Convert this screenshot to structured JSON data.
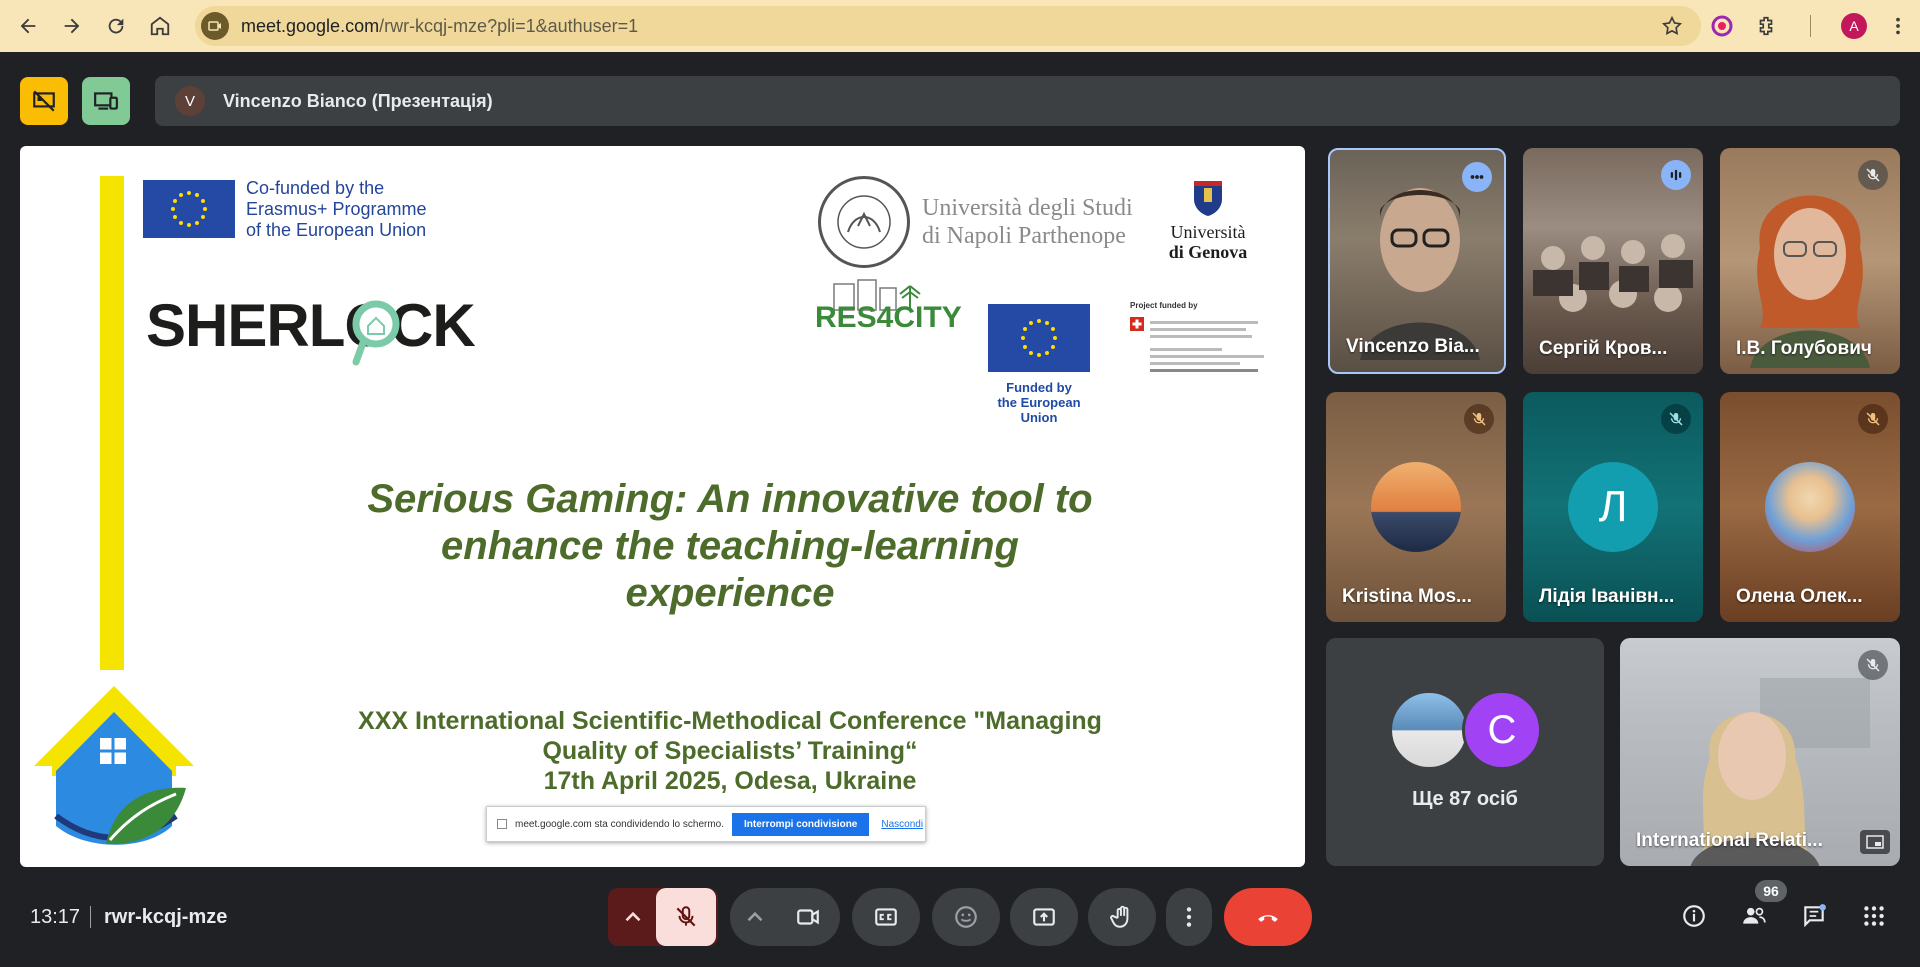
{
  "browser": {
    "url_host": "meet.google.com",
    "url_path": "/rwr-kcqj-mze?pli=1&authuser=1",
    "profile_initial": "A"
  },
  "meet": {
    "presenter_initial": "V",
    "presenter_label": "Vincenzo Bianco (Презентація)"
  },
  "slide": {
    "eu_text_1": "Co-funded by the",
    "eu_text_2": "Erasmus+ Programme",
    "eu_text_3": "of the European Union",
    "logo_sherlock": "SHERLOCK",
    "uni_napoli_1": "Università degli Studi",
    "uni_napoli_2": "di Napoli Parthenope",
    "uni_genova_1": "Università",
    "uni_genova_2": "di Genova",
    "res4city": "RES4CITY",
    "funded_eu_1": "Funded by",
    "funded_eu_2": "the European Union",
    "swiss_title": "Project funded by",
    "title_line_1": "Serious Gaming: An innovative tool to",
    "title_line_2": "enhance the teaching-learning",
    "title_line_3": "experience",
    "conf_line_1": "XXX International Scientific-Methodical Conference \"Managing",
    "conf_line_2": "Quality of Specialists’ Training“",
    "conf_line_3": "17th April 2025, Odesa, Ukraine",
    "share_text": "meet.google.com sta condividendo lo schermo.",
    "share_stop": "Interrompi condivisione",
    "share_hide": "Nascondi"
  },
  "participants": [
    {
      "name": "Vincenzo Bia..."
    },
    {
      "name": "Сергій Кров..."
    },
    {
      "name": "І.В. Голубович"
    },
    {
      "name": "Kristina Mos..."
    },
    {
      "name": "Лідія Іванівн...",
      "initial": "Л"
    },
    {
      "name": "Олена Олек..."
    },
    {
      "name": "Ще 87 осіб",
      "initial": "C"
    },
    {
      "name": "International Relati..."
    }
  ],
  "bottom": {
    "time": "13:17",
    "meeting_code": "rwr-kcqj-mze",
    "people_count": "96"
  },
  "colors": {
    "accent_yellow": "#fbbc04",
    "accent_green": "#81c995",
    "end_call_red": "#ea4335",
    "slide_green": "#4d6b2a"
  }
}
